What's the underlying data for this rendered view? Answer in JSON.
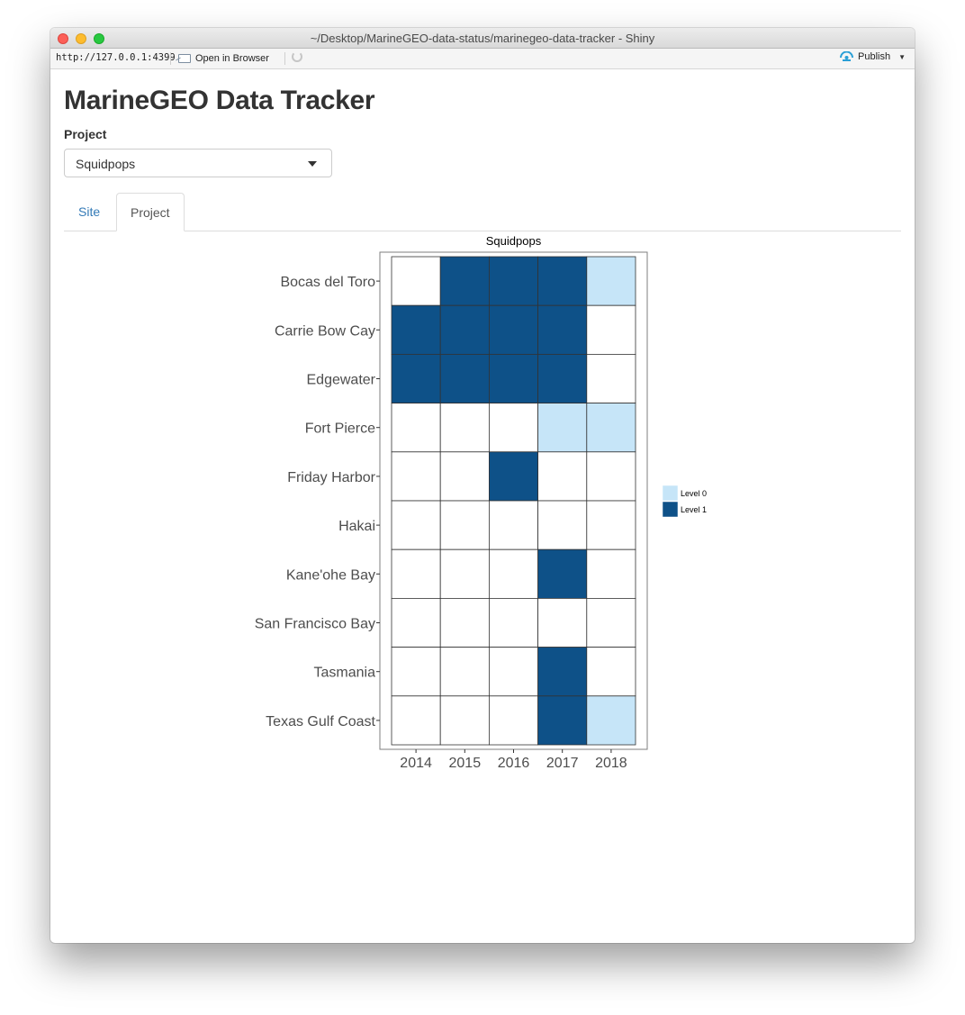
{
  "window": {
    "title": "~/Desktop/MarineGEO-data-status/marinegeo-data-tracker - Shiny"
  },
  "toolbar": {
    "url": "http://127.0.0.1:4399",
    "open_in_browser": "Open in Browser",
    "publish": "Publish"
  },
  "app": {
    "title": "MarineGEO Data Tracker",
    "project_label": "Project",
    "project_selected": "Squidpops"
  },
  "tabs": [
    {
      "label": "Site",
      "active": false
    },
    {
      "label": "Project",
      "active": true
    }
  ],
  "chart_data": {
    "type": "heatmap",
    "title": "Squidpops",
    "xlabel": "",
    "ylabel": "",
    "x": [
      "2014",
      "2015",
      "2016",
      "2017",
      "2018"
    ],
    "y": [
      "Bocas del Toro",
      "Carrie Bow Cay",
      "Edgewater",
      "Fort Pierce",
      "Friday Harbor",
      "Hakai",
      "Kane'ohe Bay",
      "San Francisco Bay",
      "Tasmania",
      "Texas Gulf Coast"
    ],
    "values": [
      [
        null,
        1,
        1,
        1,
        0
      ],
      [
        1,
        1,
        1,
        1,
        null
      ],
      [
        1,
        1,
        1,
        1,
        null
      ],
      [
        null,
        null,
        null,
        0,
        0
      ],
      [
        null,
        null,
        1,
        null,
        null
      ],
      [
        null,
        null,
        null,
        null,
        null
      ],
      [
        null,
        null,
        null,
        1,
        null
      ],
      [
        null,
        null,
        null,
        null,
        null
      ],
      [
        null,
        null,
        null,
        1,
        null
      ],
      [
        null,
        null,
        null,
        1,
        0
      ]
    ],
    "legend": [
      {
        "label": "Level 0",
        "value": 0,
        "color": "#c6e5f8"
      },
      {
        "label": "Level 1",
        "value": 1,
        "color": "#0e5188"
      }
    ],
    "empty_color": "#ffffff",
    "legend_position": "right",
    "grid": false
  }
}
